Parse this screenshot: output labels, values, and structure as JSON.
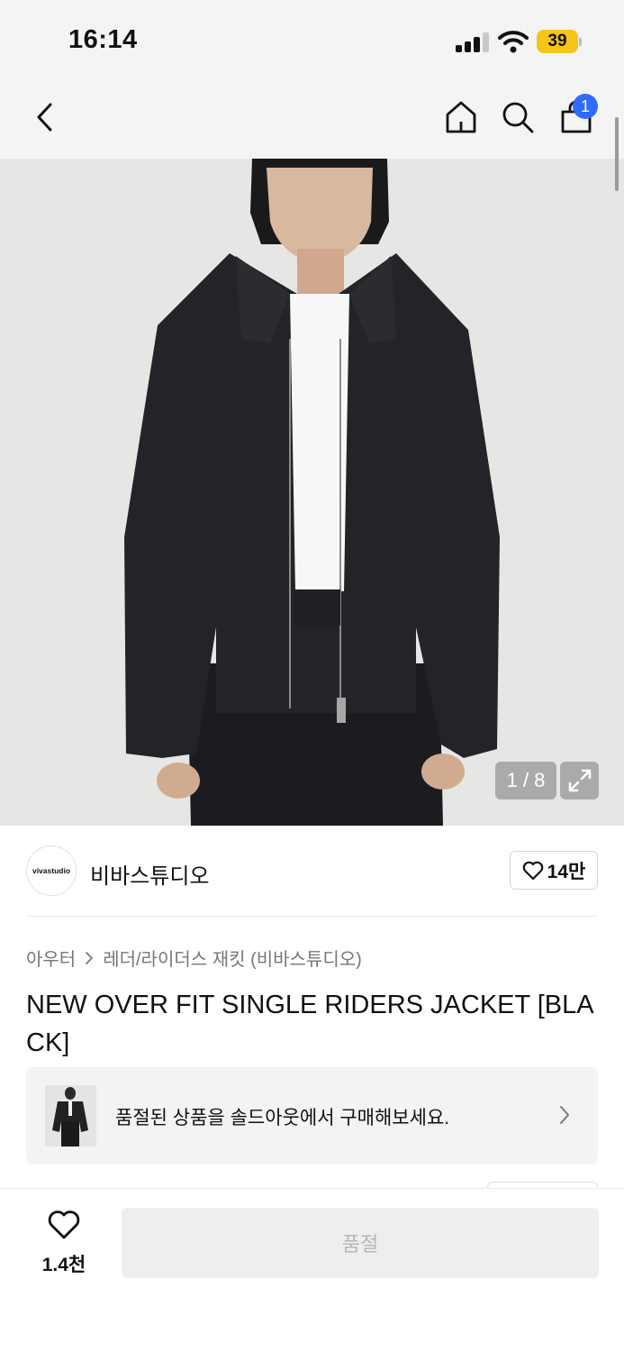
{
  "status_bar": {
    "time": "16:14",
    "battery": "39",
    "battery_color": "#f5c518"
  },
  "nav": {
    "back_icon": "chevron-left-icon",
    "home_icon": "home-icon",
    "search_icon": "search-icon",
    "cart_icon": "shopping-bag-icon",
    "cart_badge": "1",
    "badge_color": "#2f6bff"
  },
  "gallery": {
    "counter": "1 / 8",
    "expand_icon": "expand-icon"
  },
  "brand": {
    "logo_text": "vivastudio",
    "name": "비바스튜디오",
    "like_count": "14만",
    "like_icon": "heart-outline-icon"
  },
  "product": {
    "breadcrumb": [
      "아우터",
      "레더/라이더스 재킷 (비바스튜디오)"
    ],
    "title": "NEW OVER FIT SINGLE RIDERS JACKET [BLACK]"
  },
  "soldout_banner": {
    "text": "품절된 상품을 솔드아웃에서 구매해보세요.",
    "chevron_icon": "chevron-right-icon"
  },
  "bottom_bar": {
    "wish_icon": "heart-outline-icon",
    "wish_count": "1.4천",
    "buy_label": "품절"
  }
}
